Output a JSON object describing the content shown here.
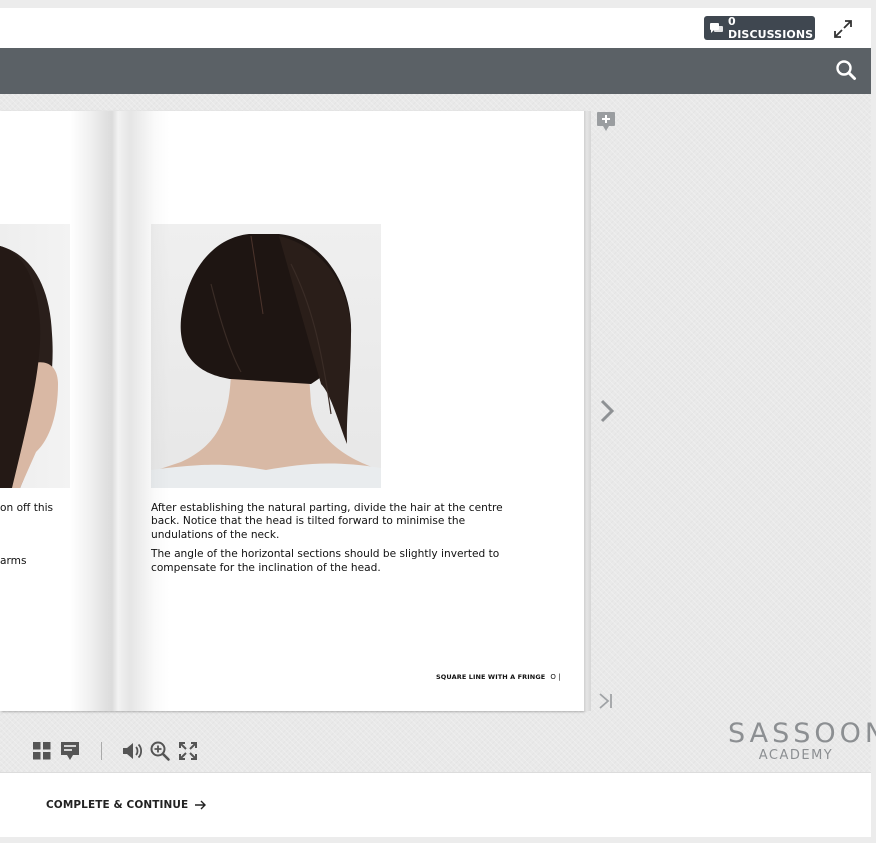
{
  "header": {
    "discussions_label": "0 DISCUSSIONS"
  },
  "page": {
    "left_text_line1": "on off this",
    "left_text_line2": "arms",
    "paragraph1": "After establishing the natural parting, divide the hair at the centre back. Notice that the head is tilted forward to minimise the undulations of the neck.",
    "paragraph2": "The angle of the horizontal sections should be slightly inverted to compensate for the inclination of the head.",
    "footer_title": "SQUARE LINE WITH A FRINGE",
    "footer_page": "O |"
  },
  "logo": {
    "line1": "SASSOON",
    "line2": "ACADEMY"
  },
  "bottom": {
    "continue_label": "COMPLETE & CONTINUE"
  },
  "icons": {
    "discussions": "chat-icon",
    "expand": "expand-icon",
    "search": "search-icon",
    "add_note": "add-note-icon",
    "next": "chevron-right-icon",
    "last": "skip-to-end-icon",
    "grid": "grid-icon",
    "notes": "notes-icon",
    "volume": "volume-icon",
    "zoom": "zoom-in-icon",
    "fullscreen": "fullscreen-icon",
    "arrow": "arrow-right-icon"
  },
  "colors": {
    "toolbar": "#5b6166",
    "discussions_button": "#3f4750",
    "logo": "#8c8f92"
  }
}
